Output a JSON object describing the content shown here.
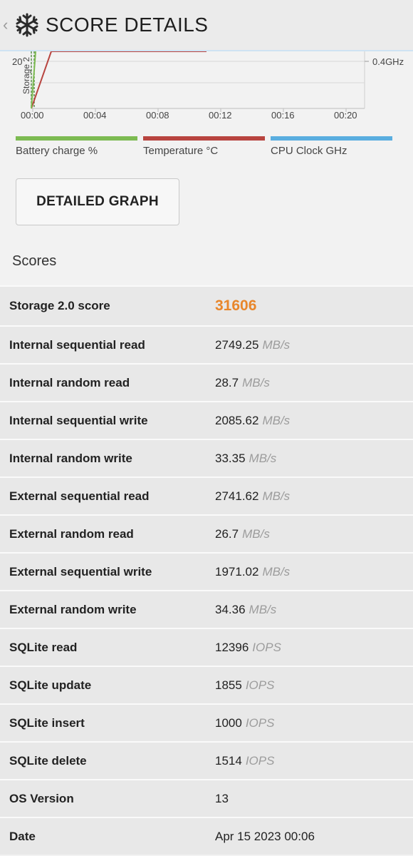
{
  "header": {
    "title": "SCORE DETAILS"
  },
  "graph": {
    "y_label_left": "20",
    "y_label_right": "0.4GHz",
    "marker_label": "Storage 2",
    "x_ticks": [
      "00:00",
      "00:04",
      "00:08",
      "00:12",
      "00:16",
      "00:20"
    ]
  },
  "legend": [
    {
      "label": "Battery charge %",
      "color": "#7dbb52"
    },
    {
      "label": "Temperature °C",
      "color": "#b8443f"
    },
    {
      "label": "CPU Clock GHz",
      "color": "#5aaee0"
    }
  ],
  "detailed_graph_button": "DETAILED GRAPH",
  "scores_title": "Scores",
  "rows": [
    {
      "label": "Storage 2.0 score",
      "value": "31606",
      "unit": ""
    },
    {
      "label": "Internal sequential read",
      "value": "2749.25",
      "unit": "MB/s"
    },
    {
      "label": "Internal random read",
      "value": "28.7",
      "unit": "MB/s"
    },
    {
      "label": "Internal sequential write",
      "value": "2085.62",
      "unit": "MB/s"
    },
    {
      "label": "Internal random write",
      "value": "33.35",
      "unit": "MB/s"
    },
    {
      "label": "External sequential read",
      "value": "2741.62",
      "unit": "MB/s"
    },
    {
      "label": "External random read",
      "value": "26.7",
      "unit": "MB/s"
    },
    {
      "label": "External sequential write",
      "value": "1971.02",
      "unit": "MB/s"
    },
    {
      "label": "External random write",
      "value": "34.36",
      "unit": "MB/s"
    },
    {
      "label": "SQLite read",
      "value": "12396",
      "unit": "IOPS"
    },
    {
      "label": "SQLite update",
      "value": "1855",
      "unit": "IOPS"
    },
    {
      "label": "SQLite insert",
      "value": "1000",
      "unit": "IOPS"
    },
    {
      "label": "SQLite delete",
      "value": "1514",
      "unit": "IOPS"
    },
    {
      "label": "OS Version",
      "value": "13",
      "unit": ""
    },
    {
      "label": "Date",
      "value": "Apr 15 2023 00:06",
      "unit": ""
    }
  ]
}
